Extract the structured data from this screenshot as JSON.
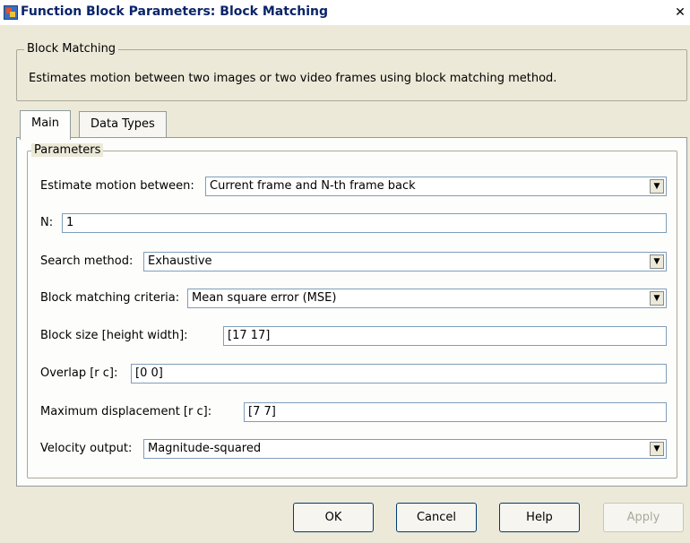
{
  "title": "Function Block Parameters: Block Matching",
  "close_glyph": "✕",
  "group_title": "Block Matching",
  "description": "Estimates motion between two images or two video frames using block matching method.",
  "tabs": [
    {
      "label": "Main",
      "active": true
    },
    {
      "label": "Data Types",
      "active": false
    }
  ],
  "parameters_title": "Parameters",
  "params": {
    "estimate_motion": {
      "label": "Estimate motion between:",
      "value": "Current frame and N-th frame back"
    },
    "n": {
      "label": "N:",
      "value": "1"
    },
    "search_method": {
      "label": "Search method:",
      "value": "Exhaustive"
    },
    "criteria": {
      "label": "Block matching criteria:",
      "value": "Mean square error (MSE)"
    },
    "block_size": {
      "label": "Block size [height width]:",
      "value": "[17 17]"
    },
    "overlap": {
      "label": "Overlap [r c]:",
      "value": "[0 0]"
    },
    "max_disp": {
      "label": "Maximum displacement [r c]:",
      "value": "[7 7]"
    },
    "velocity": {
      "label": "Velocity output:",
      "value": "Magnitude-squared"
    }
  },
  "buttons": {
    "ok": "OK",
    "cancel": "Cancel",
    "help": "Help",
    "apply": "Apply"
  },
  "colors": {
    "window_bg": "#ece9d8",
    "title_text": "#0a246a",
    "field_border": "#7f9db9"
  }
}
